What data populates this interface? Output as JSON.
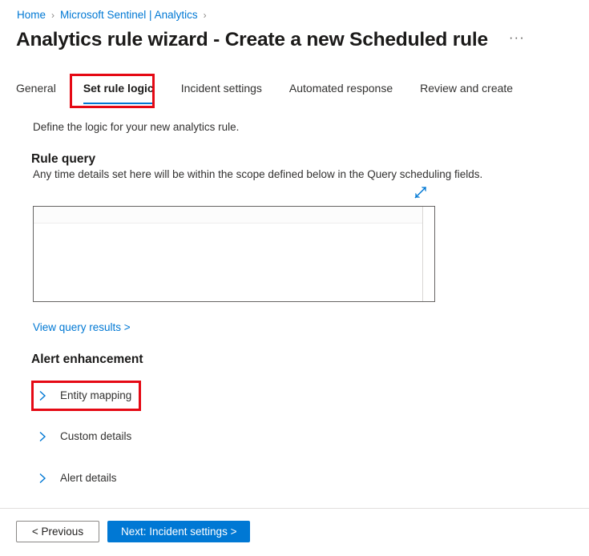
{
  "breadcrumb": {
    "items": [
      {
        "label": "Home",
        "type": "link"
      },
      {
        "label": "Microsoft Sentinel | Analytics",
        "type": "link"
      }
    ],
    "separator": "›"
  },
  "header": {
    "title": "Analytics rule wizard - Create a new Scheduled rule",
    "more_actions": "···"
  },
  "tabs": [
    {
      "label": "General",
      "active": false
    },
    {
      "label": "Set rule logic",
      "active": true
    },
    {
      "label": "Incident settings",
      "active": false
    },
    {
      "label": "Automated response",
      "active": false
    },
    {
      "label": "Review and create",
      "active": false
    }
  ],
  "main": {
    "intro": "Define the logic for your new analytics rule.",
    "rule_query": {
      "heading": "Rule query",
      "description": "Any time details set here will be within the scope defined below in the Query scheduling fields.",
      "expand_icon": "expand-diagonal-icon",
      "editor_value": ""
    },
    "view_query_results_link": "View query results >",
    "alert_enhancement": {
      "heading": "Alert enhancement",
      "sections": [
        {
          "label": "Entity mapping",
          "expanded": false,
          "highlighted": true
        },
        {
          "label": "Custom details",
          "expanded": false,
          "highlighted": false
        },
        {
          "label": "Alert details",
          "expanded": false,
          "highlighted": false
        }
      ]
    }
  },
  "footer": {
    "previous_label": "< Previous",
    "next_label": "Next: Incident settings >"
  },
  "colors": {
    "accent_blue": "#0078d4",
    "link_blue": "#0078d4",
    "annotation_red": "#e50914",
    "text_primary": "#323130",
    "text_heading": "#1b1a19",
    "editor_border": "#666463"
  }
}
